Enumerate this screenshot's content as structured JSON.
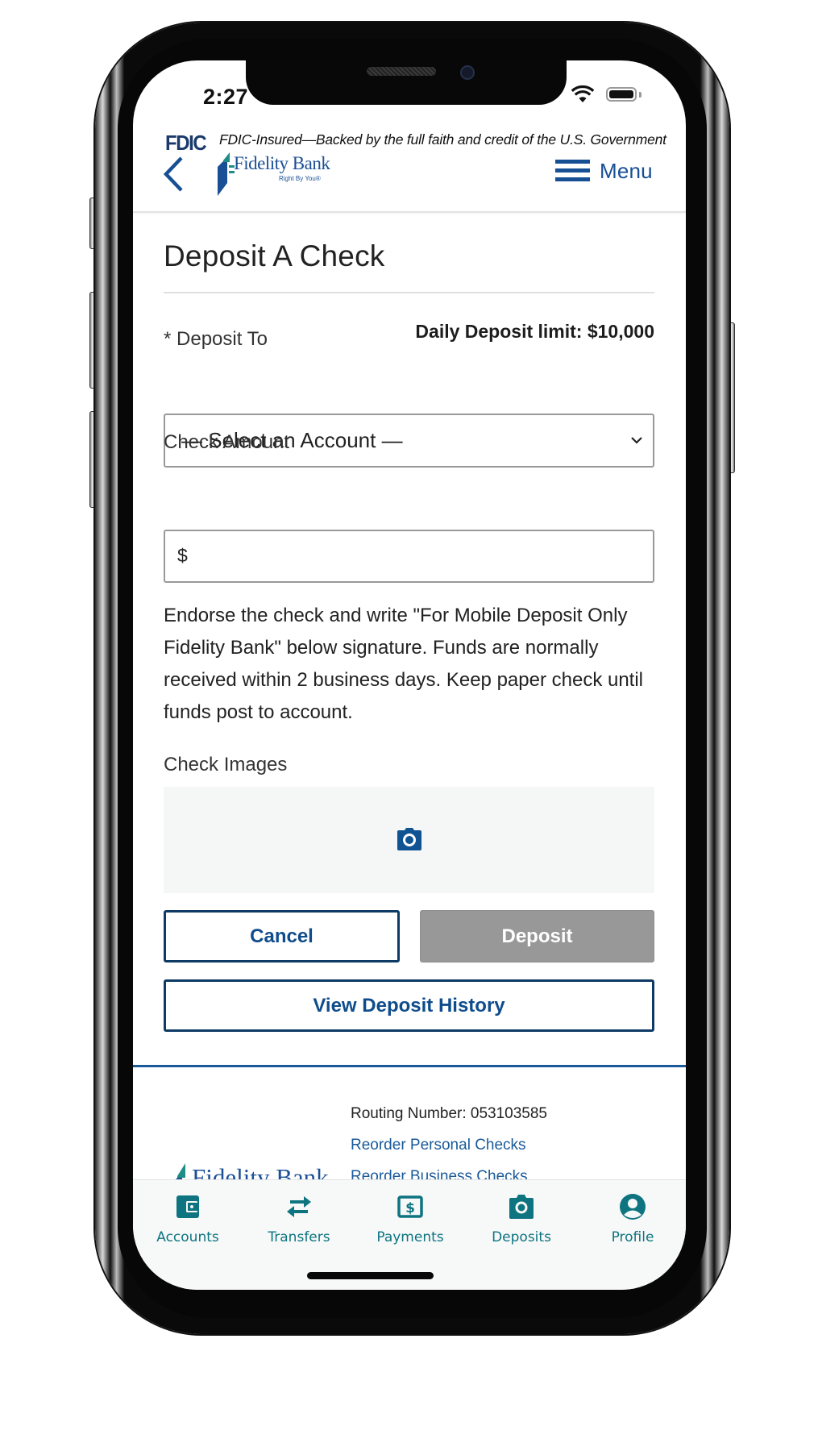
{
  "status_bar": {
    "time": "2:27",
    "wifi_icon": "wifi-icon",
    "battery_icon": "battery-icon"
  },
  "header": {
    "fdic_logo": "FDIC",
    "fdic_statement": "FDIC-Insured—Backed by the full faith and credit of the U.S. Government",
    "back_icon": "chevron-left-icon",
    "brand_name": "Fidelity Bank",
    "brand_tagline": "Right By You®",
    "menu_label": "Menu",
    "menu_icon": "hamburger-icon"
  },
  "page": {
    "title": "Deposit A Check",
    "daily_limit": "Daily Deposit limit: $10,000",
    "deposit_to_label": "* Deposit To",
    "deposit_to_selected": "— Select an Account —",
    "check_amount_label": "Check Amount",
    "check_amount_prefix": "$",
    "check_amount_value": "",
    "instructions": "Endorse the check and write \"For Mobile Deposit Only Fidelity Bank\" below signature. Funds are normally received within 2 business days. Keep paper check until funds post to account.",
    "check_images_label": "Check Images",
    "camera_icon": "camera-icon",
    "buttons": {
      "cancel": "Cancel",
      "deposit": "Deposit",
      "view_history": "View Deposit History"
    }
  },
  "footer": {
    "routing": "Routing Number: 053103585",
    "links": [
      "Reorder Personal Checks",
      "Reorder Business Checks"
    ],
    "logo_name": "Fidelity Bank"
  },
  "tabbar": {
    "items": [
      {
        "label": "Accounts",
        "icon": "wallet-icon"
      },
      {
        "label": "Transfers",
        "icon": "transfer-arrows-icon"
      },
      {
        "label": "Payments",
        "icon": "dollar-bill-icon"
      },
      {
        "label": "Deposits",
        "icon": "camera-icon"
      },
      {
        "label": "Profile",
        "icon": "user-circle-icon"
      }
    ]
  },
  "colors": {
    "brand_blue": "#174f94",
    "button_navy": "#0e3a66",
    "tab_teal": "#0d7480",
    "disabled_gray": "#989898",
    "logo_teal": "#1f8c86"
  }
}
